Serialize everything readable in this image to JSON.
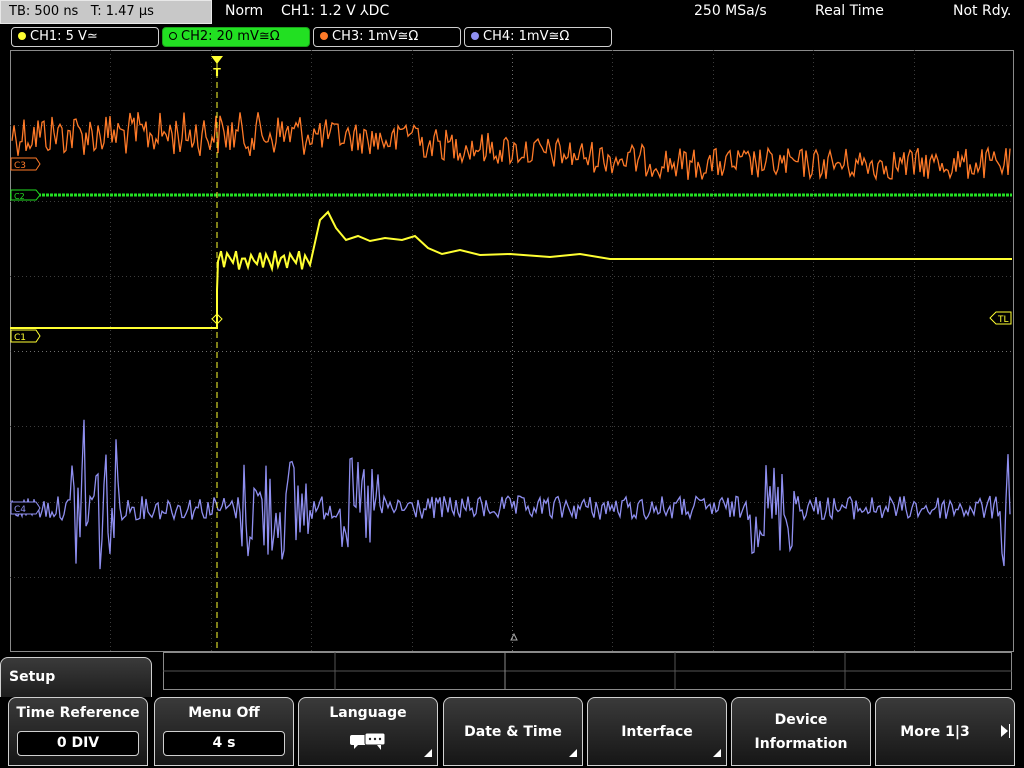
{
  "status": {
    "timebase": "TB: 500 ns   T: 1.47 µs",
    "trigger_mode": "Norm",
    "trigger_info": "CH1: 1.2 V ⅄DC",
    "sample_rate": "250 MSa/s",
    "acq_mode": "Real Time",
    "state": "Not Rdy."
  },
  "channels": [
    {
      "label": "CH1: 5 V≃",
      "color": "#ffff32",
      "active": false
    },
    {
      "label": "CH2: 20 mV≅Ω",
      "color": "#22e022",
      "active": true
    },
    {
      "label": "CH3: 1mV≅Ω",
      "color": "#ff7a28",
      "active": false
    },
    {
      "label": "CH4: 1mV≅Ω",
      "color": "#8f8ff0",
      "active": false
    }
  ],
  "markers": {
    "ch3": "C3",
    "ch2": "C2",
    "ch1": "C1",
    "ch4": "C4",
    "trigger_level": "TL",
    "trigger_pos": "T"
  },
  "colors": {
    "grid": "#3c3c3c",
    "grid_center": "#6e6e6e",
    "ch1": "#ffff32",
    "ch2": "#22e022",
    "ch3": "#ff7a28",
    "ch4": "#8f8ff0",
    "trigger": "#ffff32"
  },
  "menu": {
    "title": "Setup",
    "softkeys": [
      {
        "label": "Time Reference",
        "value": "0 DIV"
      },
      {
        "label": "Menu Off",
        "value": "4 s"
      },
      {
        "label": "Language",
        "icon": "speech-bubbles-icon"
      },
      {
        "label": "Date & Time"
      },
      {
        "label": "Interface"
      },
      {
        "label_line1": "Device",
        "label_line2": "Information"
      },
      {
        "label": "More 1|3"
      }
    ]
  }
}
